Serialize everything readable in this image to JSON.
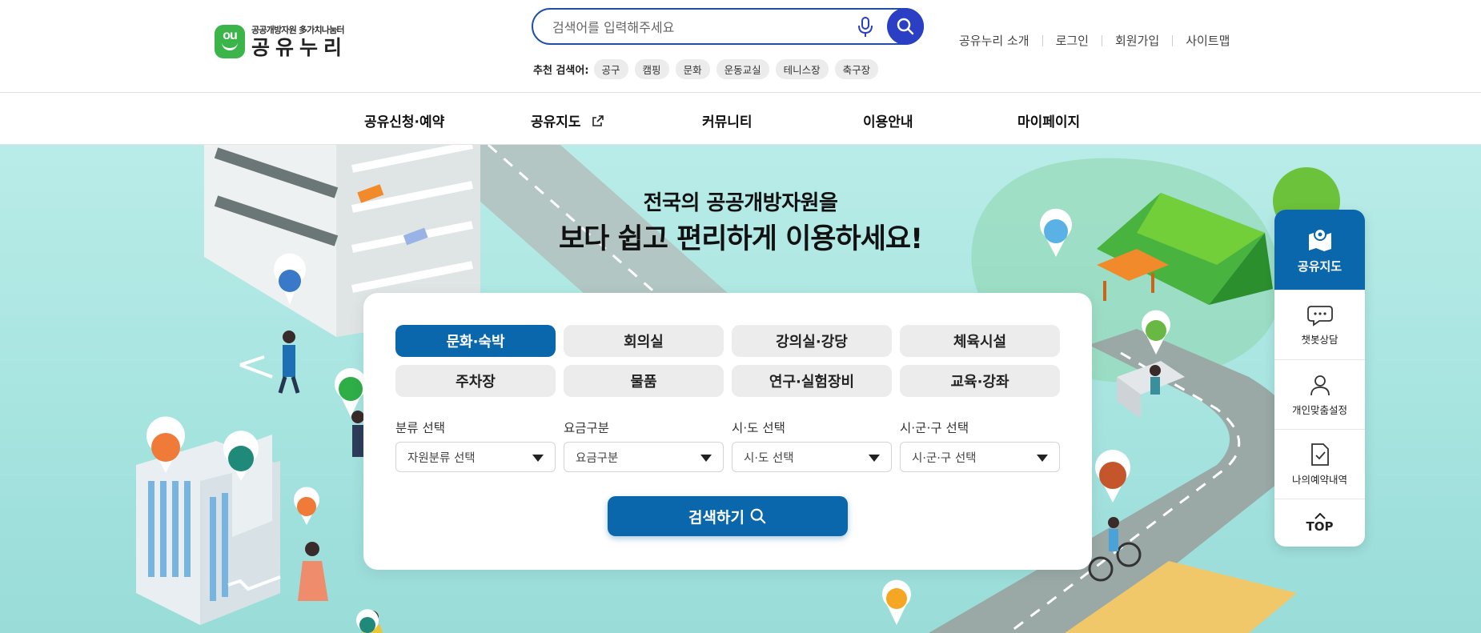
{
  "logo": {
    "sub": "공공개방자원 多가치나눔터",
    "main": "공유누리",
    "mark": "ou"
  },
  "search": {
    "placeholder": "검색어를 입력해주세요",
    "mic_icon": "mic-icon",
    "search_icon": "search-icon"
  },
  "recommend": {
    "label": "추천 검색어:",
    "keywords": [
      "공구",
      "캠핑",
      "문화",
      "운동교실",
      "테니스장",
      "축구장"
    ]
  },
  "util_links": [
    "공유누리 소개",
    "로그인",
    "회원가입",
    "사이트맵"
  ],
  "gnb": [
    "공유신청·예약",
    "공유지도",
    "커뮤니티",
    "이용안내",
    "마이페이지"
  ],
  "hero": {
    "title": "전국의 공공개방자원을",
    "subtitle": "보다 쉽고 편리하게 이용하세요!"
  },
  "categories": [
    {
      "label": "문화·숙박",
      "active": true
    },
    {
      "label": "회의실",
      "active": false
    },
    {
      "label": "강의실·강당",
      "active": false
    },
    {
      "label": "체육시설",
      "active": false
    },
    {
      "label": "주차장",
      "active": false
    },
    {
      "label": "물품",
      "active": false
    },
    {
      "label": "연구·실험장비",
      "active": false
    },
    {
      "label": "교육·강좌",
      "active": false
    }
  ],
  "filters": [
    {
      "label": "분류 선택",
      "value": "자원분류 선택"
    },
    {
      "label": "요금구분",
      "value": "요금구분"
    },
    {
      "label": "시·도 선택",
      "value": "시·도 선택"
    },
    {
      "label": "시·군·구 선택",
      "value": "시·군·구 선택"
    }
  ],
  "search_button": "검색하기",
  "quick_menu": {
    "map": "공유지도",
    "items": [
      "챗봇상담",
      "개인맞춤설정",
      "나의예약내역"
    ],
    "top": "TOP"
  },
  "colors": {
    "primary": "#0a67ac",
    "search_border": "#1f4fa8",
    "search_button": "#2a3fc4",
    "logo_green": "#3bb54a",
    "hero_bg": "#b9ece8"
  }
}
